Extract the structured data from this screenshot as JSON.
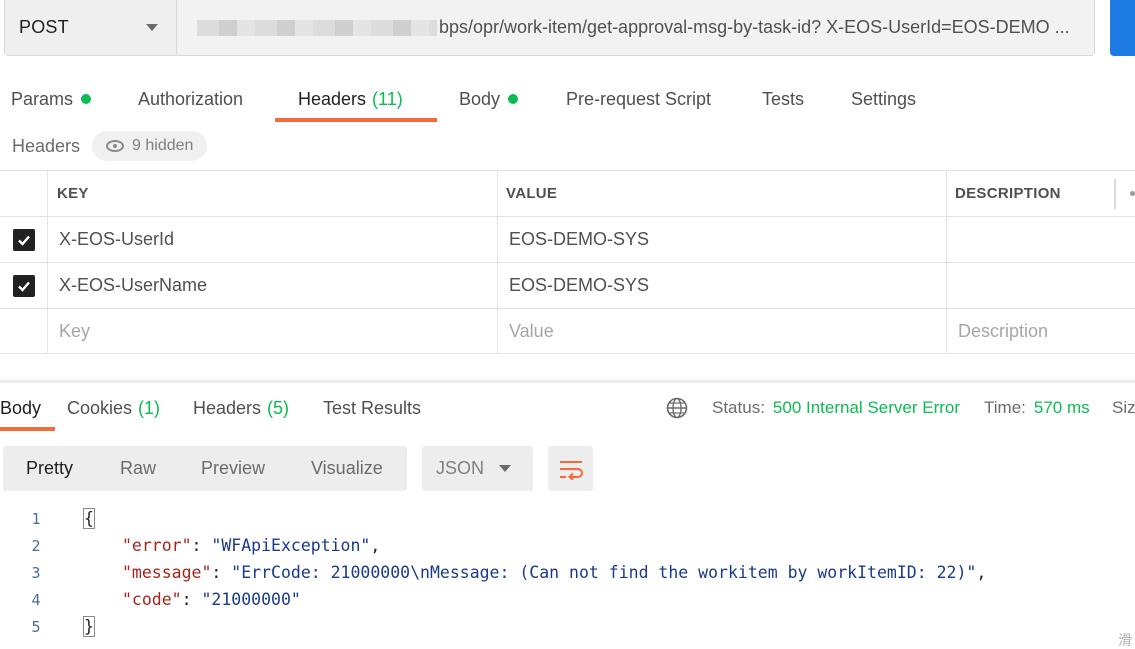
{
  "request": {
    "method": "POST",
    "url_visible": "bps/opr/work-item/get-approval-msg-by-task-id? X-EOS-UserId=EOS-DEMO ..."
  },
  "request_tabs": [
    {
      "label": "Params",
      "dot": true
    },
    {
      "label": "Authorization"
    },
    {
      "label": "Headers",
      "count": "(11)",
      "active": true
    },
    {
      "label": "Body",
      "dot": true
    },
    {
      "label": "Pre-request Script"
    },
    {
      "label": "Tests"
    },
    {
      "label": "Settings"
    }
  ],
  "headers_section": {
    "title": "Headers",
    "hidden_label": "9 hidden"
  },
  "headers_table": {
    "columns": [
      "KEY",
      "VALUE",
      "DESCRIPTION"
    ],
    "rows": [
      {
        "checked": true,
        "key": "X-EOS-UserId",
        "value": "EOS-DEMO-SYS",
        "description": ""
      },
      {
        "checked": true,
        "key": "X-EOS-UserName",
        "value": "EOS-DEMO-SYS",
        "description": ""
      }
    ],
    "placeholders": {
      "key": "Key",
      "value": "Value",
      "description": "Description"
    }
  },
  "response_tabs": [
    {
      "label": "Body",
      "active": true
    },
    {
      "label": "Cookies",
      "count": "(1)"
    },
    {
      "label": "Headers",
      "count": "(5)"
    },
    {
      "label": "Test Results"
    }
  ],
  "response_status": {
    "status_label": "Status:",
    "status_value": "500 Internal Server Error",
    "time_label": "Time:",
    "time_value": "570 ms",
    "size_label_partial": "Siz"
  },
  "view_modes": [
    "Pretty",
    "Raw",
    "Preview",
    "Visualize"
  ],
  "format_select": "JSON",
  "response_body": {
    "line_numbers": [
      "1",
      "2",
      "3",
      "4",
      "5"
    ],
    "open_brace": "{",
    "close_brace": "}",
    "fields": [
      {
        "key": "\"error\"",
        "value": "\"WFApiException\"",
        "trail": ","
      },
      {
        "key": "\"message\"",
        "value": "\"ErrCode: 21000000\\nMessage: (Can not find the workitem by workItemID: 22)\"",
        "trail": ","
      },
      {
        "key": "\"code\"",
        "value": "\"21000000\"",
        "trail": ""
      }
    ]
  },
  "corner_glyph": "滑",
  "colors": {
    "accent_orange": "#f26b3a",
    "success_green": "#0cbb52",
    "send_blue": "#1e7be4",
    "json_key": "#a8241a",
    "json_string": "#1a3a8c"
  }
}
